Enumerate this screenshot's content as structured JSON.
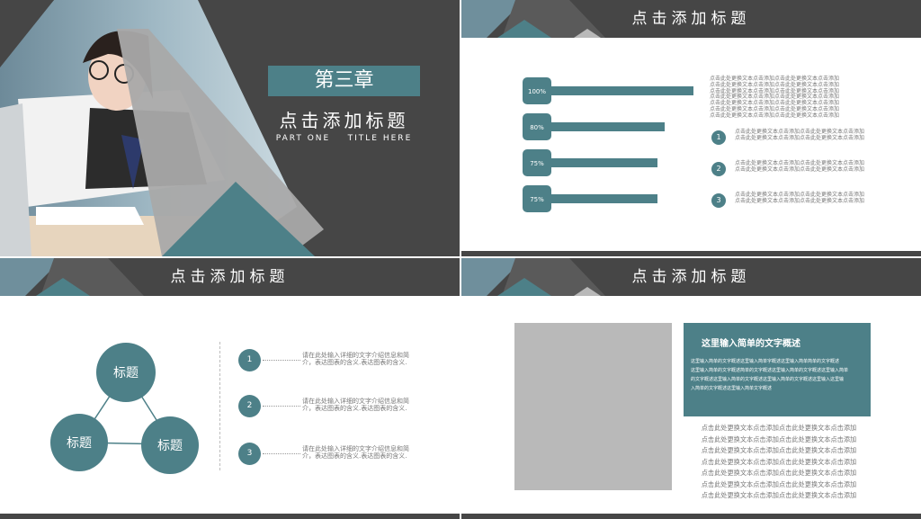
{
  "slide1": {
    "chapter": "第三章",
    "title": "点击添加标题",
    "subtitle": "PART ONE    TITLE HERE"
  },
  "slide2": {
    "title": "点击添加标题",
    "bars": [
      {
        "label": "100%",
        "value": 1.0
      },
      {
        "label": "80%",
        "value": 0.8
      },
      {
        "label": "75%",
        "value": 0.75
      },
      {
        "label": "75%",
        "value": 0.75
      }
    ],
    "intro_lines": [
      "点击此处更换文本点击添加点击此处更换文本点击添加",
      "点击此处更换文本点击添加点击此处更换文本点击添加",
      "点击此处更换文本点击添加点击此处更换文本点击添加",
      "点击此处更换文本点击添加点击此处更换文本点击添加",
      "点击此处更换文本点击添加点击此处更换文本点击添加",
      "点击此处更换文本点击添加点击此处更换文本点击添加",
      "点击此处更换文本点击添加点击此处更换文本点击添加"
    ],
    "items": [
      {
        "num": "1",
        "lines": [
          "点击此处更换文本点击添加点击此处更换文本点击添加",
          "点击此处更换文本点击添加点击此处更换文本点击添加"
        ]
      },
      {
        "num": "2",
        "lines": [
          "点击此处更换文本点击添加点击此处更换文本点击添加",
          "点击此处更换文本点击添加点击此处更换文本点击添加"
        ]
      },
      {
        "num": "3",
        "lines": [
          "点击此处更换文本点击添加点击此处更换文本点击添加",
          "点击此处更换文本点击添加点击此处更换文本点击添加"
        ]
      }
    ]
  },
  "slide3": {
    "title": "点击添加标题",
    "circles": [
      "标题",
      "标题",
      "标题"
    ],
    "items": [
      {
        "num": "1",
        "line1": "请在此处输入详细的文字介绍信息和简",
        "line2": "介，表达图表的含义.表达图表的含义."
      },
      {
        "num": "2",
        "line1": "请在此处输入详细的文字介绍信息和简",
        "line2": "介，表达图表的含义.表达图表的含义."
      },
      {
        "num": "3",
        "line1": "请在此处输入详细的文字介绍信息和简",
        "line2": "介，表达图表的含义.表达图表的含义."
      }
    ]
  },
  "slide4": {
    "title": "点击添加标题",
    "box_title": "这里输入简单的文字概述",
    "box_lines": [
      "这里输入简单的文字概述这里输入简单字概述这里输入简单简单的文字概述",
      "这里输入简单的文字概述简单的文字概述这里输入简单的文字概述这里输入简单",
      "的文字概述这里输入简单的文字概述这里输入简单的文字概述这里输入这里输",
      "入简单的文字概述这里输入简单文字概述"
    ],
    "lines": [
      "点击此处更换文本点击添加点击此处更换文本点击添加",
      "点击此处更换文本点击添加点击此处更换文本点击添加",
      "点击此处更换文本点击添加点击此处更换文本点击添加",
      "点击此处更换文本点击添加点击此处更换文本点击添加",
      "点击此处更换文本点击添加点击此处更换文本点击添加",
      "点击此处更换文本点击添加点击此处更换文本点击添加",
      "点击此处更换文本点击添加点击此处更换文本点击添加"
    ]
  },
  "colors": {
    "teal": "#4d8088",
    "dark": "#464646",
    "gray": "#b9b9b9"
  }
}
